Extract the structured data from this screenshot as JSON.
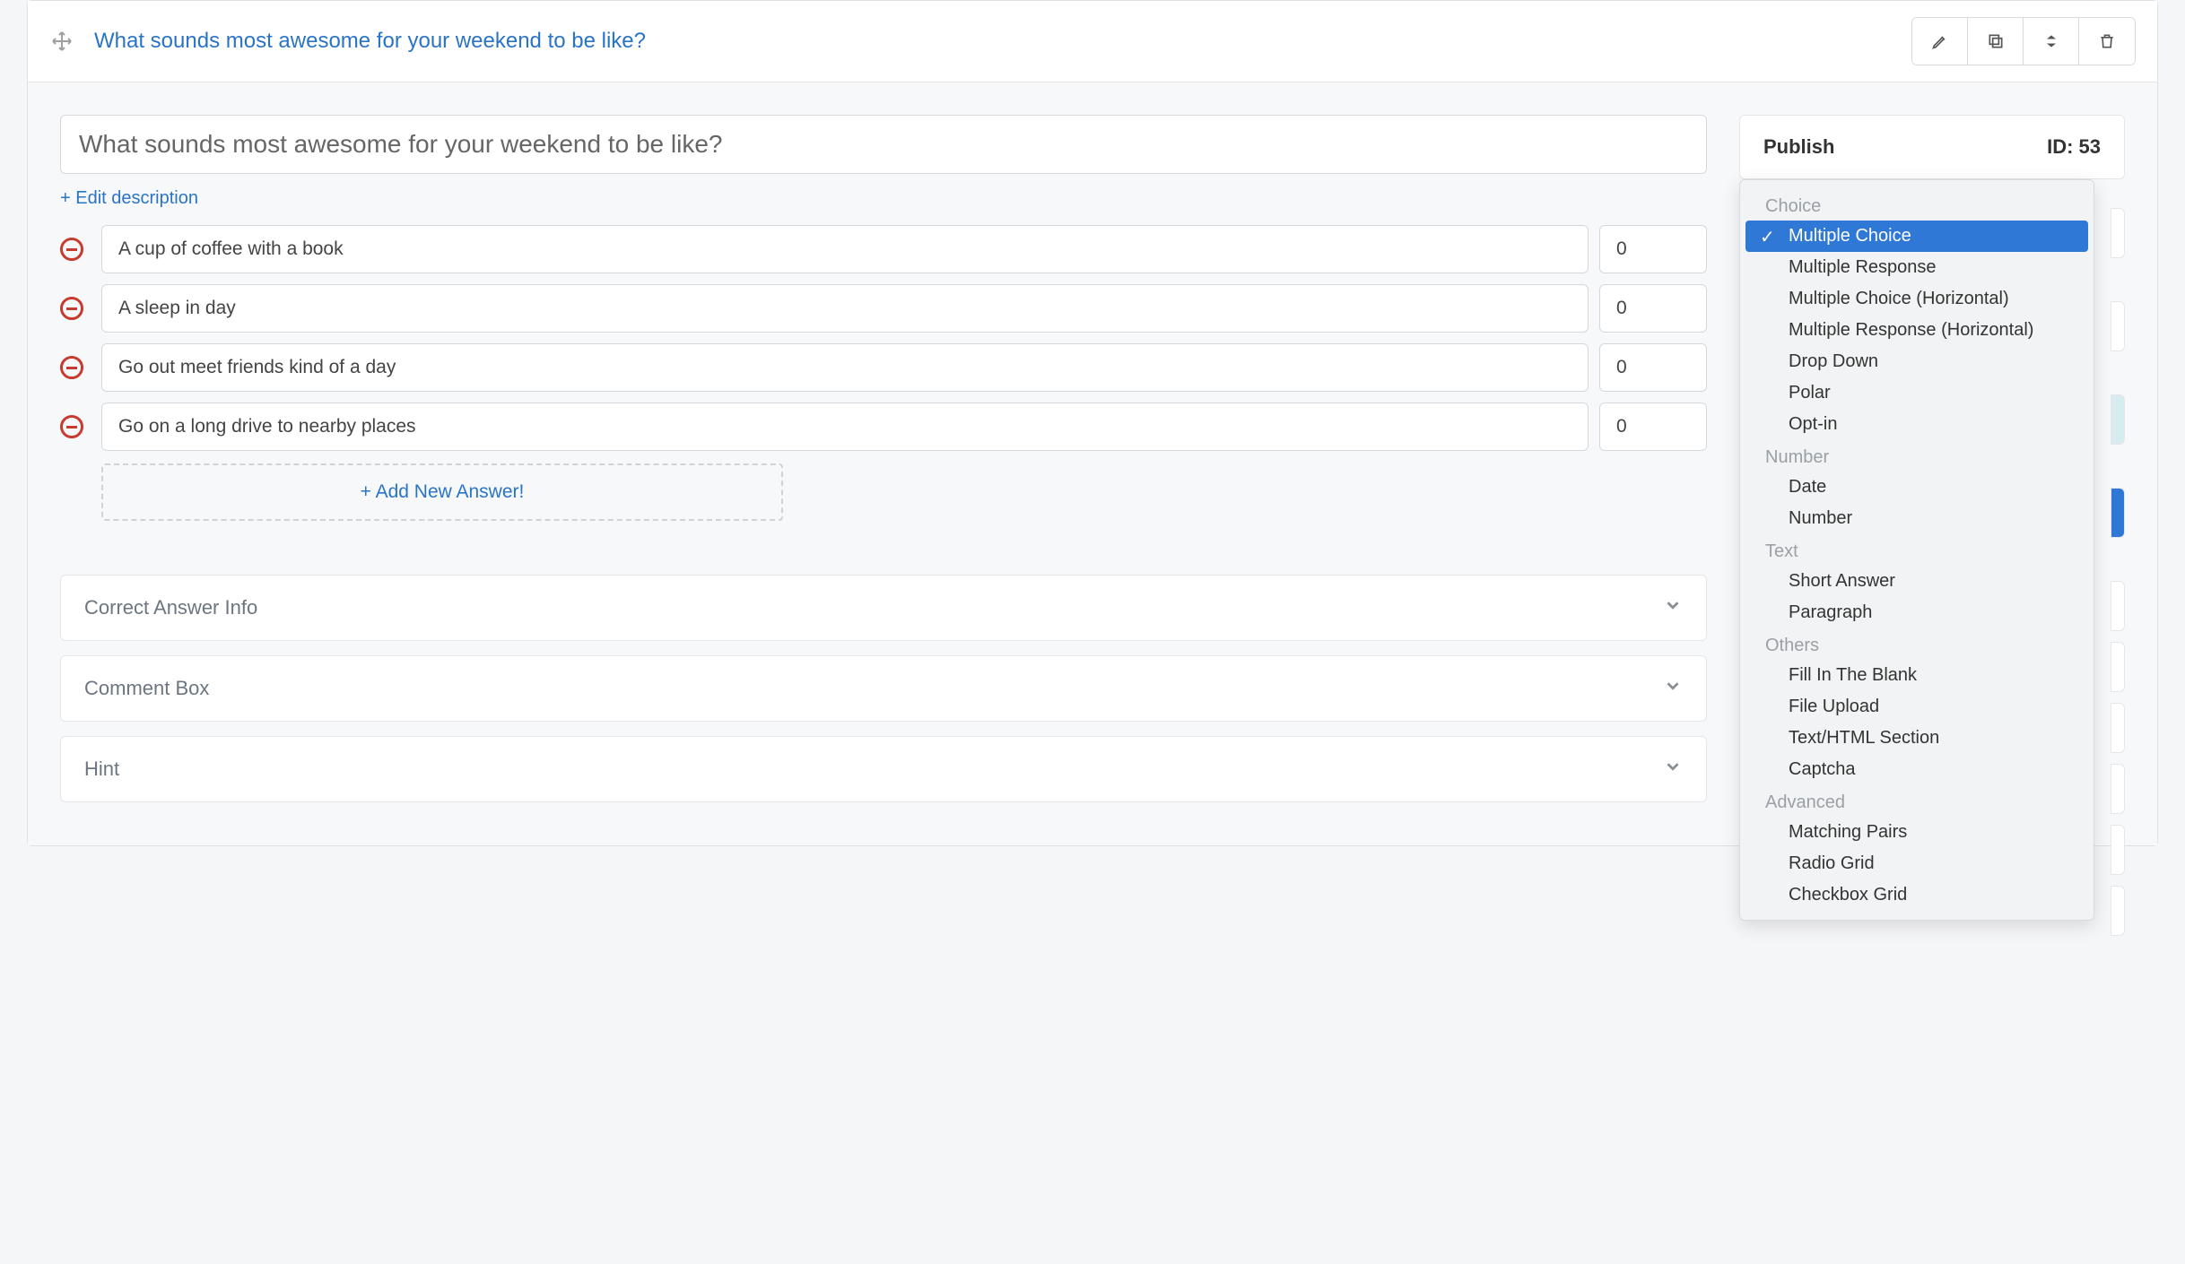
{
  "header": {
    "title": "What sounds most awesome for your weekend to be like?"
  },
  "question": {
    "text": "What sounds most awesome for your weekend to be like?",
    "edit_desc_label": "+ Edit description",
    "add_answer_label": "+ Add New Answer!",
    "answers": [
      {
        "text": "A cup of coffee with a book",
        "score": "0"
      },
      {
        "text": "A sleep in day",
        "score": "0"
      },
      {
        "text": "Go out meet friends kind of a day",
        "score": "0"
      },
      {
        "text": "Go on a long drive to nearby places",
        "score": "0"
      }
    ]
  },
  "sections": {
    "correct_answer": "Correct Answer Info",
    "comment_box": "Comment Box",
    "hint": "Hint"
  },
  "publish": {
    "label": "Publish",
    "id_label": "ID: 53"
  },
  "type_dropdown": {
    "groups": [
      {
        "label": "Choice",
        "items": [
          {
            "label": "Multiple Choice",
            "selected": true
          },
          {
            "label": "Multiple Response"
          },
          {
            "label": "Multiple Choice (Horizontal)"
          },
          {
            "label": "Multiple Response (Horizontal)"
          },
          {
            "label": "Drop Down"
          },
          {
            "label": "Polar"
          },
          {
            "label": "Opt-in"
          }
        ]
      },
      {
        "label": "Number",
        "items": [
          {
            "label": "Date"
          },
          {
            "label": "Number"
          }
        ]
      },
      {
        "label": "Text",
        "items": [
          {
            "label": "Short Answer"
          },
          {
            "label": "Paragraph"
          }
        ]
      },
      {
        "label": "Others",
        "items": [
          {
            "label": "Fill In The Blank"
          },
          {
            "label": "File Upload"
          },
          {
            "label": "Text/HTML Section"
          },
          {
            "label": "Captcha"
          }
        ]
      },
      {
        "label": "Advanced",
        "items": [
          {
            "label": "Matching Pairs"
          },
          {
            "label": "Radio Grid"
          },
          {
            "label": "Checkbox Grid"
          }
        ]
      }
    ]
  }
}
